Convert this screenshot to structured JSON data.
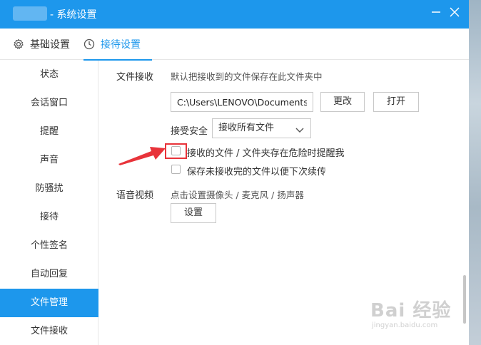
{
  "window": {
    "title": "- 系统设置",
    "minimize_icon": "minimize-icon",
    "close_icon": "close-icon"
  },
  "tabs": [
    {
      "label": "基础设置",
      "icon": "gear-icon",
      "active": false
    },
    {
      "label": "接待设置",
      "icon": "clock-icon",
      "active": true
    }
  ],
  "sidebar": {
    "items": [
      {
        "label": "状态"
      },
      {
        "label": "会话窗口"
      },
      {
        "label": "提醒"
      },
      {
        "label": "声音"
      },
      {
        "label": "防骚扰"
      },
      {
        "label": "接待"
      },
      {
        "label": "个性签名"
      },
      {
        "label": "自动回复"
      },
      {
        "label": "文件管理",
        "active": true
      },
      {
        "label": "文件接收"
      }
    ]
  },
  "file_receive": {
    "section_label": "文件接收",
    "description": "默认把接收到的文件保存在此文件夹中",
    "path_value": "C:\\Users\\LENOVO\\Documents\\I",
    "change_button": "更改",
    "open_button": "打开",
    "security_label": "接受安全",
    "security_select": "接收所有文件",
    "checkbox_danger_label": "接收的文件 / 文件夹存在危险时提醒我",
    "checkbox_danger_checked": false,
    "checkbox_resume_label": "保存未接收完的文件以便下次续传",
    "checkbox_resume_checked": false
  },
  "voice_video": {
    "section_label": "语音视频",
    "description": "点击设置摄像头 / 麦克风 / 扬声器",
    "settings_button": "设置"
  },
  "watermark": {
    "text": "Bai 经验",
    "sub": "jingyan.baidu.com"
  },
  "colors": {
    "accent": "#1d97ec",
    "highlight_red": "#e8333a"
  }
}
